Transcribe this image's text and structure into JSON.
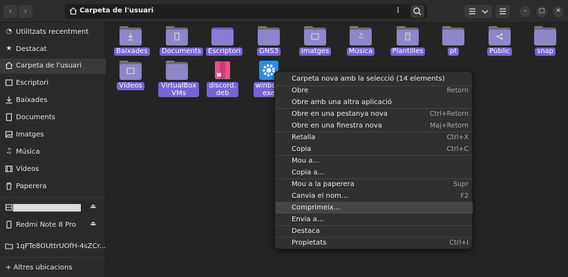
{
  "header": {
    "path_label": "Carpeta de l'usuari"
  },
  "sidebar": {
    "items": [
      {
        "label": "Utilitzats recentment",
        "icon": "clock-icon"
      },
      {
        "label": "Destacat",
        "icon": "star-icon"
      },
      {
        "label": "Carpeta de l'usuari",
        "icon": "home-icon"
      },
      {
        "label": "Escriptori",
        "icon": "desktop-icon"
      },
      {
        "label": "Baixades",
        "icon": "download-icon"
      },
      {
        "label": "Documents",
        "icon": "document-icon"
      },
      {
        "label": "Imatges",
        "icon": "image-icon"
      },
      {
        "label": "Música",
        "icon": "music-icon"
      },
      {
        "label": "Vídeos",
        "icon": "video-icon"
      },
      {
        "label": "Paperera",
        "icon": "trash-icon"
      }
    ],
    "devices": [
      {
        "label": "Redmi Note 8 Pro"
      },
      {
        "label": "1qFTe8OUttrUOfH-4sZCr..."
      }
    ],
    "other_locations": "+ Altres ubicacions"
  },
  "files": [
    {
      "name": "Baixades",
      "icon": "download-icon"
    },
    {
      "name": "Documents",
      "icon": "document-icon"
    },
    {
      "name": "Escriptori",
      "icon": "desktop-icon"
    },
    {
      "name": "GNS3",
      "icon": "folder-icon"
    },
    {
      "name": "Imatges",
      "icon": "image-icon"
    },
    {
      "name": "Música",
      "icon": "music-icon"
    },
    {
      "name": "Plantilles",
      "icon": "template-icon"
    },
    {
      "name": "pt",
      "icon": "folder-icon"
    },
    {
      "name": "Públic",
      "icon": "share-icon"
    },
    {
      "name": "snap",
      "icon": "folder-icon"
    },
    {
      "name": "Vídeos",
      "icon": "video-icon"
    },
    {
      "name": "VirtualBox",
      "name2": "VMs",
      "icon": "folder-icon"
    },
    {
      "name": "discord.",
      "name2": "deb",
      "icon": "package-icon"
    },
    {
      "name": "winbox-",
      "name2": "exe",
      "icon": "gear-icon"
    }
  ],
  "context_menu": {
    "items": [
      {
        "label": "Carpeta nova amb la selecció (14 elements)",
        "shortcut": ""
      },
      {
        "label": "Obre",
        "shortcut": "Retorn"
      },
      {
        "label": "Obre amb una altra aplicació",
        "shortcut": ""
      },
      {
        "label": "Obre en una pestanya nova",
        "shortcut": "Ctrl+Retorn"
      },
      {
        "label": "Obre en una finestra nova",
        "shortcut": "Maj+Retorn"
      },
      {
        "label": "Retalla",
        "shortcut": "Ctrl+X"
      },
      {
        "label": "Copia",
        "shortcut": "Ctrl+C"
      },
      {
        "label": "Mou a…",
        "shortcut": ""
      },
      {
        "label": "Copia a…",
        "shortcut": ""
      },
      {
        "label": "Mou a la paperera",
        "shortcut": "Supr"
      },
      {
        "label": "Canvia el nom…",
        "shortcut": "F2"
      },
      {
        "label": "Comprimeix…",
        "shortcut": ""
      },
      {
        "label": "Envia a…",
        "shortcut": ""
      },
      {
        "label": "Destaca",
        "shortcut": ""
      },
      {
        "label": "Propietats",
        "shortcut": "Ctrl+I"
      }
    ]
  },
  "colors": {
    "accent": "#7763d6",
    "background": "#242424",
    "sidebar": "#2a2a2a"
  }
}
